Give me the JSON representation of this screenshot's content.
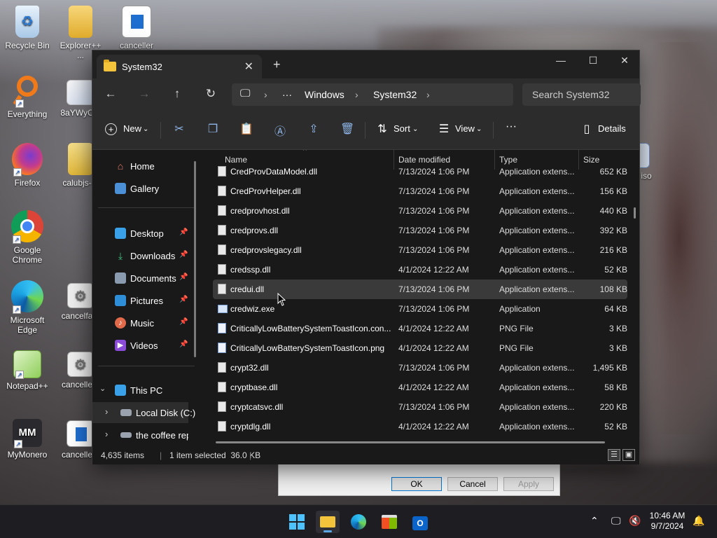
{
  "desktop": {
    "icons": [
      {
        "label": "Recycle Bin"
      },
      {
        "label": "Explorer++ ..."
      },
      {
        "label": "canceller"
      },
      {
        "label": "Everything"
      },
      {
        "label": "8aYWyC..."
      },
      {
        "label": "Firefox"
      },
      {
        "label": "calubjs-..."
      },
      {
        "label": "Google Chrome"
      },
      {
        "label": "Microsoft Edge"
      },
      {
        "label": "cancelfa..."
      },
      {
        "label": "Notepad++"
      },
      {
        "label": "cancelle..."
      },
      {
        "label": "MyMonero"
      },
      {
        "label": "cancelle..."
      },
      {
        "label": "iso"
      }
    ]
  },
  "dialog": {
    "ok": "OK",
    "cancel": "Cancel",
    "apply": "Apply"
  },
  "window": {
    "tab_title": "System32",
    "close_tab": "✕",
    "new_tab": "+",
    "minimize": "—",
    "maximize": "☐",
    "close": "✕"
  },
  "address": {
    "more": "···",
    "crumbs": [
      "Windows",
      "System32"
    ],
    "search_placeholder": "Search System32"
  },
  "toolbar": {
    "new": "New",
    "sort": "Sort",
    "view": "View",
    "more": "···",
    "details": "Details"
  },
  "nav": {
    "home": "Home",
    "gallery": "Gallery",
    "desktop": "Desktop",
    "downloads": "Downloads",
    "documents": "Documents",
    "pictures": "Pictures",
    "music": "Music",
    "videos": "Videos",
    "this_pc": "This PC",
    "local_disk": "Local Disk (C:)",
    "network": "the coffee repo"
  },
  "columns": {
    "name": "Name",
    "date": "Date modified",
    "type": "Type",
    "size": "Size"
  },
  "files": [
    {
      "name": "CredProvDataModel.dll",
      "date": "7/13/2024 1:06 PM",
      "type": "Application extens...",
      "size": "652 KB",
      "kind": "dll"
    },
    {
      "name": "CredProvHelper.dll",
      "date": "7/13/2024 1:06 PM",
      "type": "Application extens...",
      "size": "156 KB",
      "kind": "dll"
    },
    {
      "name": "credprovhost.dll",
      "date": "7/13/2024 1:06 PM",
      "type": "Application extens...",
      "size": "440 KB",
      "kind": "dll"
    },
    {
      "name": "credprovs.dll",
      "date": "7/13/2024 1:06 PM",
      "type": "Application extens...",
      "size": "392 KB",
      "kind": "dll"
    },
    {
      "name": "credprovslegacy.dll",
      "date": "7/13/2024 1:06 PM",
      "type": "Application extens...",
      "size": "216 KB",
      "kind": "dll"
    },
    {
      "name": "credssp.dll",
      "date": "4/1/2024 12:22 AM",
      "type": "Application extens...",
      "size": "52 KB",
      "kind": "dll"
    },
    {
      "name": "credui.dll",
      "date": "7/13/2024 1:06 PM",
      "type": "Application extens...",
      "size": "108 KB",
      "kind": "dll",
      "selected": true
    },
    {
      "name": "credwiz.exe",
      "date": "7/13/2024 1:06 PM",
      "type": "Application",
      "size": "64 KB",
      "kind": "exe"
    },
    {
      "name": "CriticallyLowBatterySystemToastIcon.con...",
      "date": "4/1/2024 12:22 AM",
      "type": "PNG File",
      "size": "3 KB",
      "kind": "png"
    },
    {
      "name": "CriticallyLowBatterySystemToastIcon.png",
      "date": "4/1/2024 12:22 AM",
      "type": "PNG File",
      "size": "3 KB",
      "kind": "png"
    },
    {
      "name": "crypt32.dll",
      "date": "7/13/2024 1:06 PM",
      "type": "Application extens...",
      "size": "1,495 KB",
      "kind": "dll"
    },
    {
      "name": "cryptbase.dll",
      "date": "4/1/2024 12:22 AM",
      "type": "Application extens...",
      "size": "58 KB",
      "kind": "dll"
    },
    {
      "name": "cryptcatsvc.dll",
      "date": "7/13/2024 1:06 PM",
      "type": "Application extens...",
      "size": "220 KB",
      "kind": "dll"
    },
    {
      "name": "cryptdlg.dll",
      "date": "4/1/2024 12:22 AM",
      "type": "Application extens...",
      "size": "52 KB",
      "kind": "dll"
    }
  ],
  "status": {
    "items": "4,635 items",
    "selected": "1 item selected  36.0 KB"
  },
  "clock": {
    "time": "10:46 AM",
    "date": "9/7/2024"
  }
}
